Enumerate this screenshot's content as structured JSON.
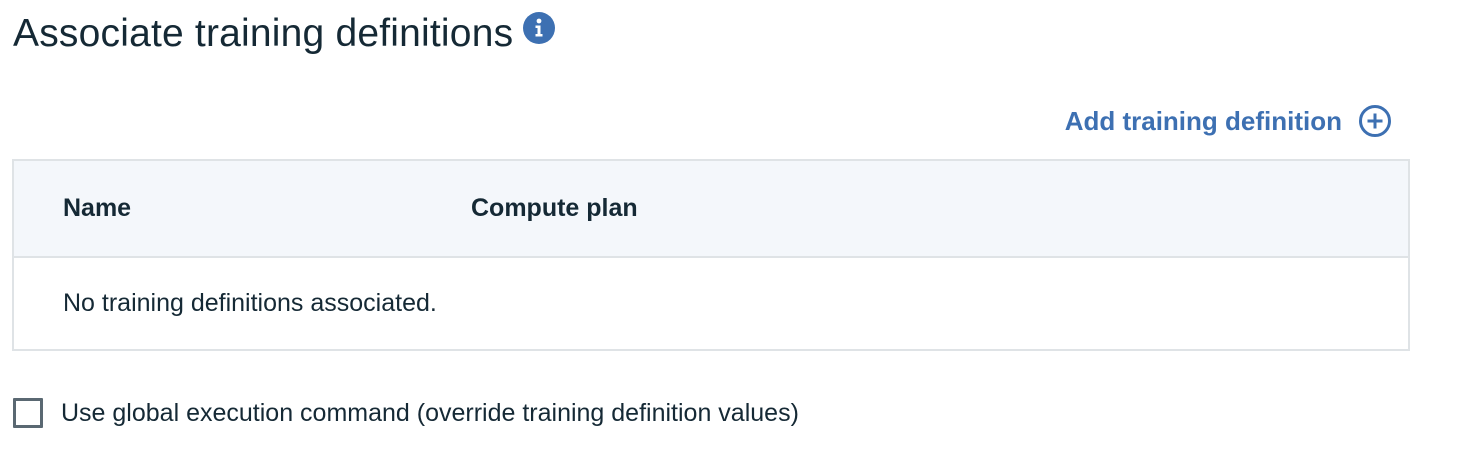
{
  "header": {
    "title": "Associate training definitions",
    "info_icon": "info-icon"
  },
  "actions": {
    "add_label": "Add training definition",
    "add_icon": "plus-circle-icon",
    "accent_color": "#3d70b2"
  },
  "table": {
    "columns": [
      "Name",
      "Compute plan"
    ],
    "empty_message": "No training definitions associated.",
    "rows": []
  },
  "options": {
    "global_command": {
      "label": "Use global execution command (override training definition values)",
      "checked": false
    }
  }
}
